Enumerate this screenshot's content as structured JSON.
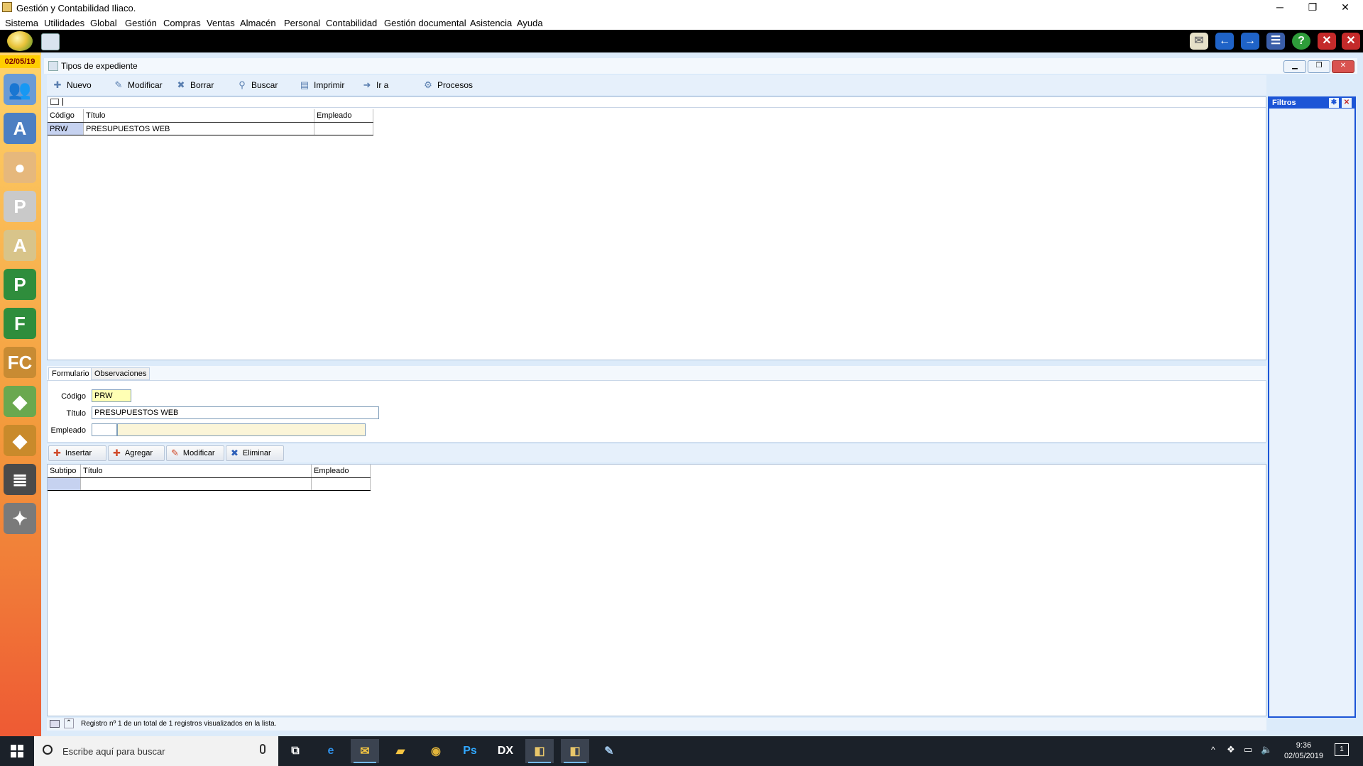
{
  "window": {
    "title": "Gestión y Contabilidad Iliaco.",
    "minimize_glyph": "─",
    "restore_glyph": "❐",
    "close_glyph": "✕"
  },
  "menu": [
    "Sistema",
    "Utilidades",
    "Global",
    "Gestión",
    "Compras",
    "Ventas",
    "Almacén",
    "Personal",
    "Contabilidad",
    "Gestión documental",
    "Asistencia",
    "Ayuda"
  ],
  "toolbar_icons": [
    "mail-icon",
    "back-arrow-icon",
    "forward-arrow-icon",
    "menu-icon",
    "help-icon",
    "close-window-icon",
    "close-all-icon"
  ],
  "sidebar": {
    "date": "02/05/19",
    "icons": [
      {
        "name": "users-icon",
        "glyph": "👥",
        "color": "#6a9bd6"
      },
      {
        "name": "agenda-icon",
        "glyph": "A",
        "color": "#4d7fc2"
      },
      {
        "name": "user-icon",
        "glyph": "●",
        "color": "#e6b87c"
      },
      {
        "name": "user-p-icon",
        "glyph": "P",
        "color": "#c9c9c9"
      },
      {
        "name": "user-a-icon",
        "glyph": "A",
        "color": "#d8c48a"
      },
      {
        "name": "letter-p-icon",
        "glyph": "P",
        "color": "#2f8d3c"
      },
      {
        "name": "letter-f-icon",
        "glyph": "F",
        "color": "#2f8d3c"
      },
      {
        "name": "letter-fc-icon",
        "glyph": "FC",
        "color": "#c88b33"
      },
      {
        "name": "bag-icon",
        "glyph": "◆",
        "color": "#6aa84f"
      },
      {
        "name": "box-icon",
        "glyph": "◆",
        "color": "#c98a2b"
      },
      {
        "name": "list-icon",
        "glyph": "≣",
        "color": "#4a4a4a"
      },
      {
        "name": "tools-icon",
        "glyph": "✦",
        "color": "#7a7a7a"
      }
    ]
  },
  "doc_window": {
    "title": "Tipos de expediente",
    "actions": [
      {
        "label": "Nuevo",
        "name": "nuevo-button",
        "icon": "new-icon",
        "glyph": "✚"
      },
      {
        "label": "Modificar",
        "name": "modificar-button",
        "icon": "edit-icon",
        "glyph": "✎"
      },
      {
        "label": "Borrar",
        "name": "borrar-button",
        "icon": "delete-icon",
        "glyph": "✖"
      },
      {
        "label": "Buscar",
        "name": "buscar-button",
        "icon": "search-icon",
        "glyph": "⚲"
      },
      {
        "label": "Imprimir",
        "name": "imprimir-button",
        "icon": "print-icon",
        "glyph": "▤"
      },
      {
        "label": "Ir a",
        "name": "ir-a-button",
        "icon": "goto-icon",
        "glyph": "➜"
      },
      {
        "label": "Procesos",
        "name": "procesos-button",
        "icon": "process-icon",
        "glyph": "⚙"
      }
    ]
  },
  "list": {
    "columns": [
      "Código",
      "Título",
      "Empleado"
    ],
    "rows": [
      [
        "PRW",
        "PRESUPUESTOS WEB",
        ""
      ]
    ]
  },
  "filters": {
    "title": "Filtros"
  },
  "tabs": [
    "Formulario",
    "Observaciones"
  ],
  "form": {
    "codigo_label": "Código",
    "codigo_value": "PRW",
    "titulo_label": "Título",
    "titulo_value": "PRESUPUESTOS WEB",
    "empleado_label": "Empleado",
    "empleado_value": "",
    "empleado_name": ""
  },
  "detail_actions": [
    {
      "label": "Insertar",
      "name": "insertar-button",
      "icon": "insert-icon",
      "glyph": "✚"
    },
    {
      "label": "Agregar",
      "name": "agregar-button",
      "icon": "add-icon",
      "glyph": "✚"
    },
    {
      "label": "Modificar",
      "name": "modificar-detalle-button",
      "icon": "edit-icon",
      "glyph": "✎"
    },
    {
      "label": "Eliminar",
      "name": "eliminar-button",
      "icon": "delete-icon",
      "glyph": "✖"
    }
  ],
  "detail_list": {
    "columns": [
      "Subtipo",
      "Título",
      "Empleado"
    ],
    "rows": [
      [
        "",
        "",
        ""
      ]
    ]
  },
  "status": "Registro nº 1 de un total de 1 registros visualizados en la lista.",
  "taskbar": {
    "search_placeholder": "Escribe aquí para buscar",
    "time": "9:36",
    "date": "02/05/2019",
    "notification_count": "1",
    "apps": [
      {
        "name": "task-view-icon",
        "glyph": "⧉",
        "color": "#ffffff",
        "active": false
      },
      {
        "name": "edge-icon",
        "glyph": "e",
        "color": "#2f8fe6",
        "active": false
      },
      {
        "name": "mail-app-icon",
        "glyph": "✉",
        "color": "#f4c542",
        "active": true
      },
      {
        "name": "explorer-icon",
        "glyph": "▰",
        "color": "#f4c542",
        "active": false
      },
      {
        "name": "chrome-icon",
        "glyph": "◉",
        "color": "#e2b53b",
        "active": false
      },
      {
        "name": "photoshop-icon",
        "glyph": "Ps",
        "color": "#31a8ff",
        "active": false
      },
      {
        "name": "dx-icon",
        "glyph": "DX",
        "color": "#ffffff",
        "active": false
      },
      {
        "name": "iliaco-app-icon",
        "glyph": "◧",
        "color": "#e8c66a",
        "active": true
      },
      {
        "name": "iliaco-app-2-icon",
        "glyph": "◧",
        "color": "#e8c66a",
        "active": true
      },
      {
        "name": "paint-icon",
        "glyph": "✎",
        "color": "#9fc5e8",
        "active": false
      }
    ]
  }
}
